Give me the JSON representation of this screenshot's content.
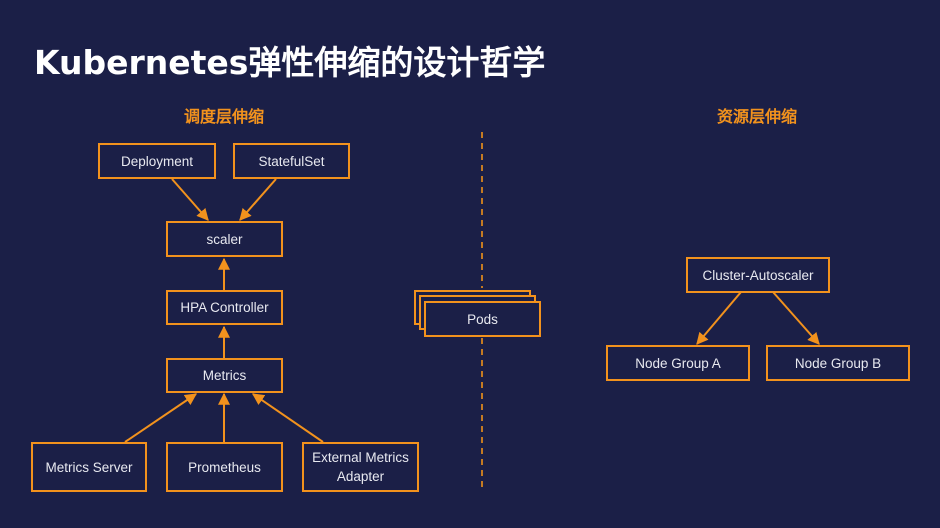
{
  "title": "Kubernetes弹性伸缩的设计哲学",
  "sections": {
    "scheduling": "调度层伸缩",
    "resource": "资源层伸缩"
  },
  "nodes": {
    "deployment": "Deployment",
    "statefulset": "StatefulSet",
    "scaler": "scaler",
    "hpa_controller": "HPA Controller",
    "metrics": "Metrics",
    "metrics_server": "Metrics Server",
    "prometheus": "Prometheus",
    "external_metrics_adapter_line1": "External Metrics",
    "external_metrics_adapter_line2": "Adapter",
    "pods": "Pods",
    "cluster_autoscaler": "Cluster-Autoscaler",
    "node_group_a": "Node Group A",
    "node_group_b": "Node Group B"
  },
  "edges": [
    {
      "from": "deployment",
      "to": "scaler"
    },
    {
      "from": "statefulset",
      "to": "scaler"
    },
    {
      "from": "hpa_controller",
      "to": "scaler"
    },
    {
      "from": "metrics",
      "to": "hpa_controller"
    },
    {
      "from": "metrics_server",
      "to": "metrics"
    },
    {
      "from": "prometheus",
      "to": "metrics"
    },
    {
      "from": "external_metrics_adapter",
      "to": "metrics"
    },
    {
      "from": "cluster_autoscaler",
      "to": "node_group_a"
    },
    {
      "from": "cluster_autoscaler",
      "to": "node_group_b"
    }
  ],
  "colors": {
    "background": "#1b1f47",
    "accent": "#f2921d",
    "text": "#e8e9f0",
    "title": "#ffffff"
  }
}
